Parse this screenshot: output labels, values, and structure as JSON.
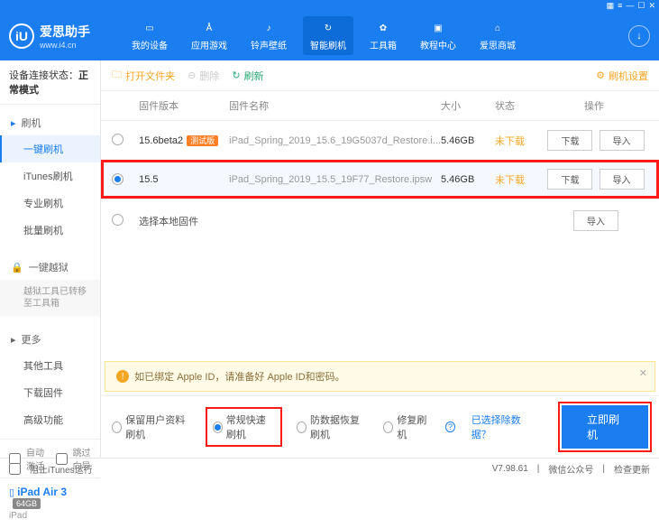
{
  "titlebar_icons": [
    "▦",
    "≡",
    "—",
    "☐",
    "✕"
  ],
  "logo": {
    "glyph": "iU",
    "title": "爱思助手",
    "url": "www.i4.cn"
  },
  "nav": [
    {
      "icon": "☐",
      "label": "我的设备"
    },
    {
      "icon": "▲",
      "label": "应用游戏"
    },
    {
      "icon": "♪",
      "label": "铃声壁纸"
    },
    {
      "icon": "↻",
      "label": "智能刷机"
    },
    {
      "icon": "✿",
      "label": "工具箱"
    },
    {
      "icon": "▣",
      "label": "教程中心"
    },
    {
      "icon": "⌂",
      "label": "爱思商城"
    }
  ],
  "sidebar": {
    "status_label": "设备连接状态：",
    "status_value": "正常模式",
    "section_flash": {
      "head": "刷机",
      "items": [
        "一键刷机",
        "iTunes刷机",
        "专业刷机",
        "批量刷机"
      ]
    },
    "section_jail": {
      "head": "一键越狱",
      "note": "越狱工具已转移至工具箱"
    },
    "section_more": {
      "head": "更多",
      "items": [
        "其他工具",
        "下载固件",
        "高级功能"
      ]
    },
    "auto_activate": "自动激活",
    "skip_guide": "跳过向导",
    "device": {
      "name": "iPad Air 3",
      "badge": "64GB",
      "sub": "iPad"
    }
  },
  "toolbar": {
    "open_folder": "打开文件夹",
    "delete": "删除",
    "refresh": "刷新",
    "settings": "刷机设置"
  },
  "table": {
    "headers": {
      "ver": "固件版本",
      "name": "固件名称",
      "size": "大小",
      "status": "状态",
      "ops": "操作"
    },
    "rows": [
      {
        "version": "15.6beta2",
        "beta": "测试版",
        "name": "iPad_Spring_2019_15.6_19G5037d_Restore.i...",
        "size": "5.46GB",
        "status": "未下载",
        "btn1": "下载",
        "btn2": "导入",
        "selected": false
      },
      {
        "version": "15.5",
        "beta": "",
        "name": "iPad_Spring_2019_15.5_19F77_Restore.ipsw",
        "size": "5.46GB",
        "status": "未下载",
        "btn1": "下载",
        "btn2": "导入",
        "selected": true
      }
    ],
    "local": {
      "label": "选择本地固件",
      "btn": "导入"
    }
  },
  "warning": {
    "icon": "!",
    "text": "如已绑定 Apple ID，请准备好 Apple ID和密码。"
  },
  "options": {
    "opt1": "保留用户资料刷机",
    "opt2": "常规快速刷机",
    "opt3": "防数据恢复刷机",
    "opt4": "修复刷机",
    "link": "已选择除数据？",
    "primary": "立即刷机"
  },
  "statusbar": {
    "block_itunes": "阻止iTunes运行",
    "version": "V7.98.61",
    "wechat": "微信公众号",
    "check_update": "检查更新"
  }
}
